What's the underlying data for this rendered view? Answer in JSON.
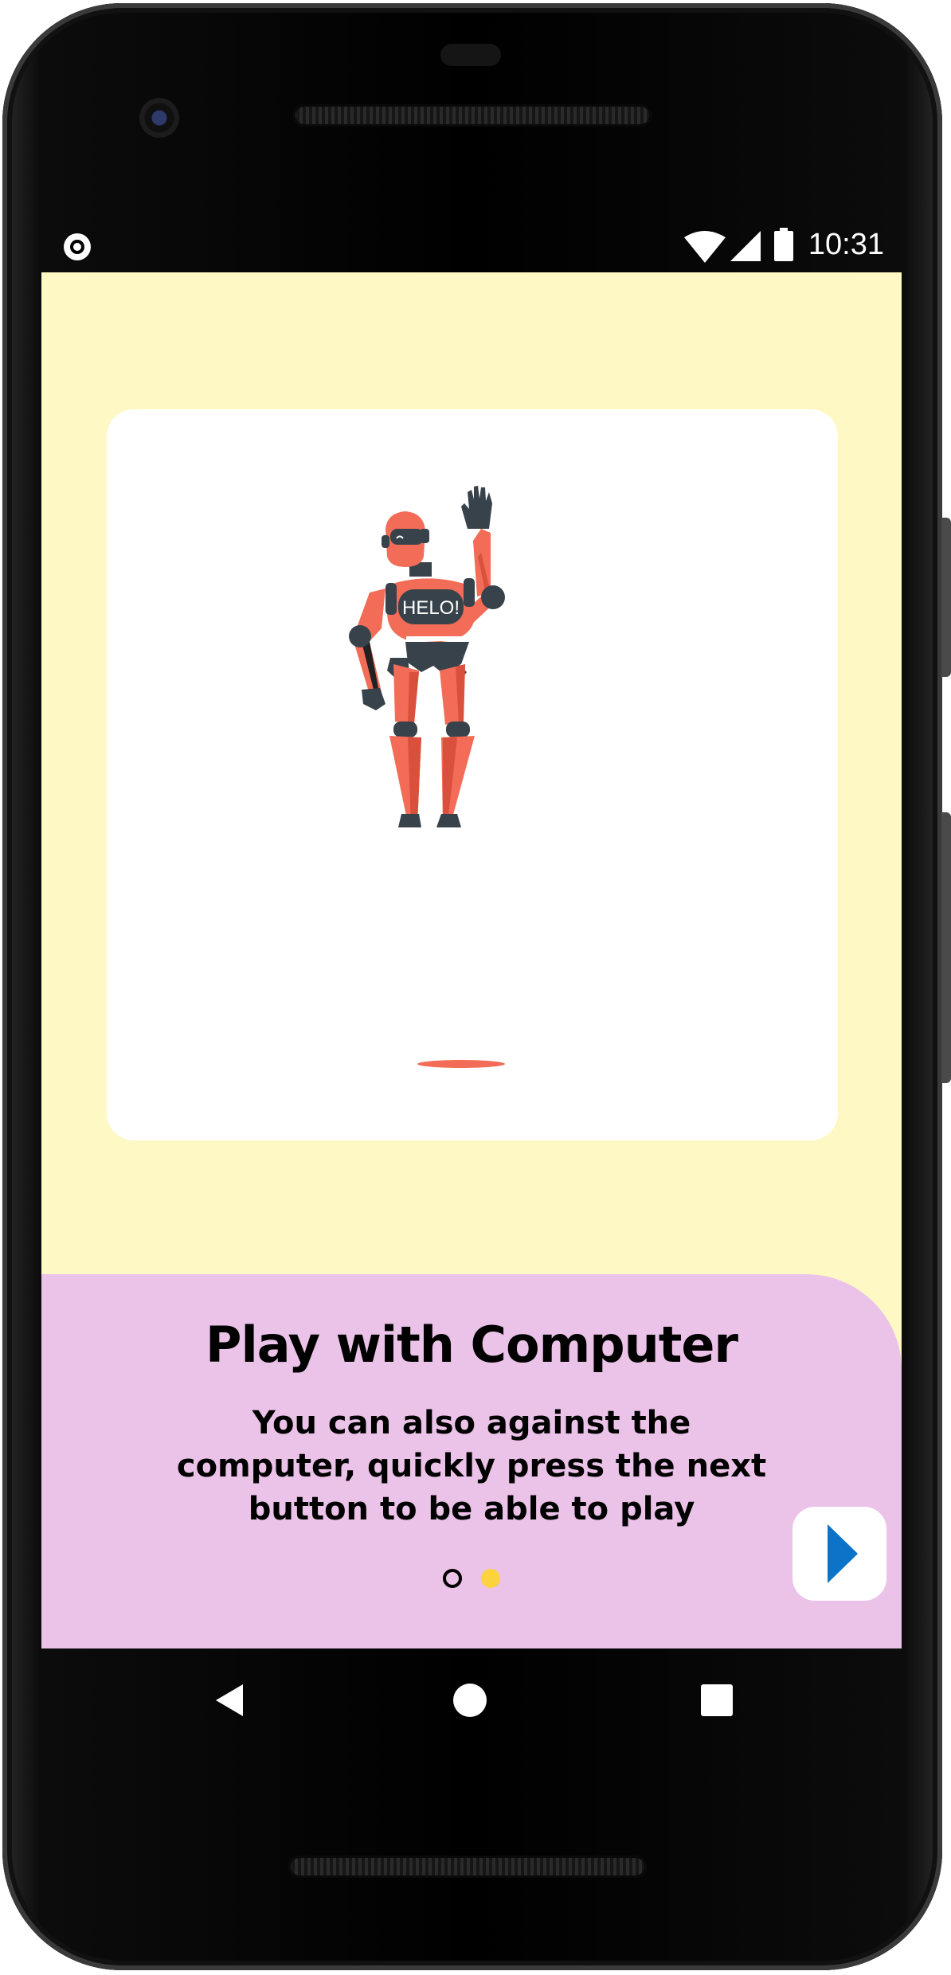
{
  "status_bar": {
    "time": "10:31",
    "icons": [
      "record-icon",
      "wifi-icon",
      "cellular-signal-icon",
      "battery-icon"
    ]
  },
  "onboarding": {
    "illustration_text": "HELO!",
    "title": "Play with Computer",
    "description": "You can also against the computer, quickly press the next button to be able to play",
    "page_indicator": {
      "total": 2,
      "current": 2
    },
    "next_icon": "play-arrow-icon"
  },
  "nav_bar": {
    "icons": [
      "back-icon",
      "home-icon",
      "recents-icon"
    ]
  },
  "colors": {
    "screen_background": "#fef8c4",
    "panel_background": "#ebc2e8",
    "card_background": "#ffffff",
    "active_dot": "#fcd33d",
    "next_arrow": "#0b73c8",
    "robot_orange": "#f26c57",
    "robot_dark": "#37424a"
  }
}
